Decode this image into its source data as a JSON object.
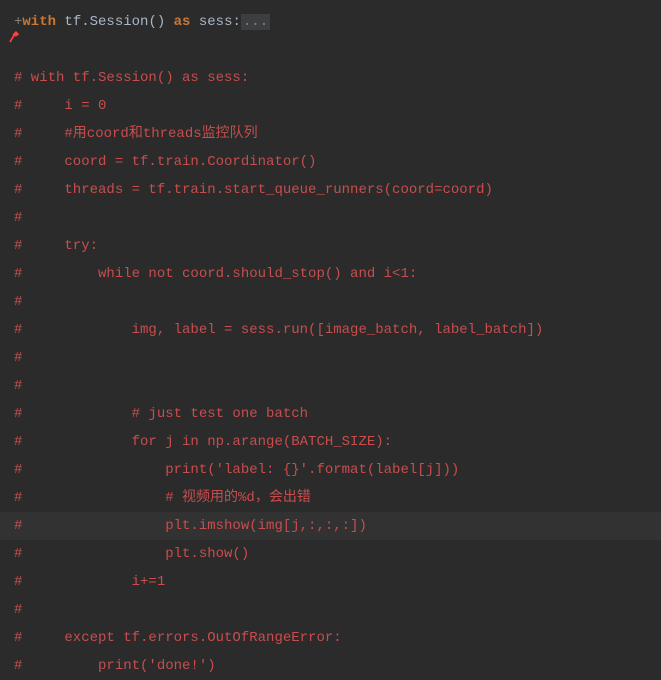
{
  "line1": {
    "plus": "+",
    "with": "with",
    "tfSession": " tf.Session",
    "parens": "()",
    "space": " ",
    "as": "as",
    "sess": " sess",
    "colon": ":",
    "fold": "..."
  },
  "comments": {
    "l2": "# with tf.Session() as sess:",
    "l3": "#     i = 0",
    "l4": "#     #用coord和threads监控队列",
    "l5": "#     coord = tf.train.Coordinator()",
    "l6": "#     threads = tf.train.start_queue_runners(coord=coord)",
    "l7": "#",
    "l8": "#     try:",
    "l9": "#         while not coord.should_stop() and i<1:",
    "l10": "#",
    "l11": "#             img, label = sess.run([image_batch, label_batch])",
    "l12": "#",
    "l13": "#",
    "l14": "#             # just test one batch",
    "l15": "#             for j in np.arange(BATCH_SIZE):",
    "l16": "#                 print('label: {}'.format(label[j]))",
    "l17": "#                 # 视频用的%d，会出错",
    "l18": "#                 plt.imshow(img[j,:,:,:])",
    "l19": "#                 plt.show()",
    "l20": "#             i+=1",
    "l21": "#",
    "l22": "#     except tf.errors.OutOfRangeError:",
    "l23": "#         print('done!')"
  }
}
